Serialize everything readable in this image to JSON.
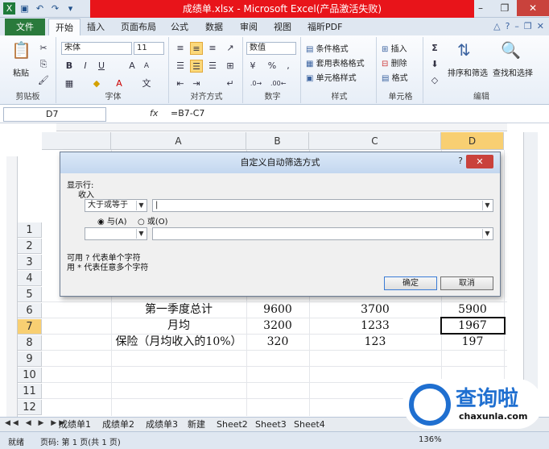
{
  "window": {
    "title": "成绩单.xlsx - Microsoft Excel(产品激活失败)"
  },
  "ribbon_tabs": [
    {
      "label": "文件"
    },
    {
      "label": "开始"
    },
    {
      "label": "插入"
    },
    {
      "label": "页面布局"
    },
    {
      "label": "公式"
    },
    {
      "label": "数据"
    },
    {
      "label": "审阅"
    },
    {
      "label": "视图"
    },
    {
      "label": "福昕PDF"
    }
  ],
  "ribbon": {
    "paste_label": "粘贴",
    "clipboard_label": "剪贴板",
    "font_name": "宋体",
    "font_size": "11",
    "font_label": "字体",
    "bold": "B",
    "italic": "I",
    "underline": "U",
    "font_a_big": "A",
    "font_a_small": "A",
    "align_label": "对齐方式",
    "number_format": "数值",
    "number_label": "数字",
    "percent": "%",
    "comma": ",",
    "cond_format": "条件格式",
    "table_format": "套用表格格式",
    "cell_style": "单元格样式",
    "styles_label": "样式",
    "insert": "插入",
    "delete": "删除",
    "format": "格式",
    "cells_label": "单元格",
    "sort_filter": "排序和筛选",
    "find_select": "查找和选择",
    "editing_label": "编辑",
    "sigma": "Σ"
  },
  "formula_bar": {
    "name_box": "D7",
    "fx": "fx",
    "formula": "=B7-C7"
  },
  "columns": [
    {
      "label": "A"
    },
    {
      "label": "B"
    },
    {
      "label": "C"
    },
    {
      "label": "D"
    }
  ],
  "rows": [
    "1",
    "2",
    "3",
    "4",
    "5",
    "6",
    "7",
    "8",
    "9",
    "10",
    "11",
    "12"
  ],
  "cells": {
    "r6": {
      "a": "第一季度总计",
      "b": "9600",
      "c": "3700",
      "d": "5900"
    },
    "r7": {
      "a": "月均",
      "b": "3200",
      "c": "1233",
      "d": "1967"
    },
    "r8": {
      "a": "保险（月均收入的10%）",
      "b": "320",
      "c": "123",
      "d": "197"
    }
  },
  "sheets": [
    {
      "label": "成绩单1"
    },
    {
      "label": "成绩单2"
    },
    {
      "label": "成绩单3"
    },
    {
      "label": "新建"
    },
    {
      "label": "Sheet2"
    },
    {
      "label": "Sheet3"
    },
    {
      "label": "Sheet4"
    }
  ],
  "status": {
    "ready": "就绪",
    "page": "页码: 第 1 页(共 1 页)",
    "zoom": "136%"
  },
  "dialog": {
    "title": "自定义自动筛选方式",
    "help": "?",
    "show_rows": "显示行:",
    "field": "收入",
    "op1": "大于或等于",
    "val1": "|",
    "and_label": "与(A)",
    "or_label": "或(O)",
    "op2": "",
    "val2": "",
    "hint1": "可用 ? 代表单个字符",
    "hint2": "用 * 代表任意多个字符",
    "ok": "确定",
    "cancel": "取消"
  },
  "watermark": {
    "brand": "查询啦",
    "url": "chaxunla.com"
  }
}
